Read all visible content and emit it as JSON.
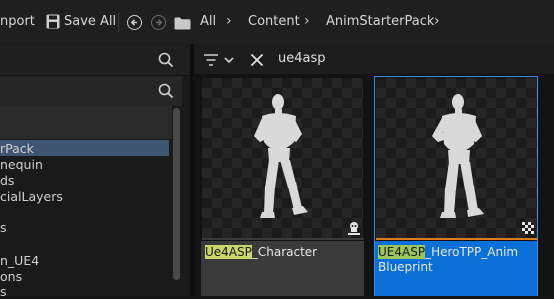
{
  "toolbar": {
    "import_label": "nport",
    "save_all_label": "Save All"
  },
  "breadcrumb": [
    "All",
    "Content",
    "AnimStarterPack"
  ],
  "search": {
    "query": "ue4asp"
  },
  "tree": {
    "items": [
      "rPack",
      "nequin",
      "ds",
      "cialLayers",
      "s",
      "n_UE4",
      "ons",
      "s"
    ],
    "selected_index": 0
  },
  "assets": [
    {
      "highlight": "Ue4ASP",
      "rest_line1": "_Character",
      "line2": "",
      "selected": false
    },
    {
      "highlight": "UE4ASP",
      "rest_line1": "_HeroTPP_Anim",
      "line2": "Blueprint",
      "selected": true
    }
  ],
  "colors": {
    "accent_blue": "#0a6fd6",
    "selection_border": "#3a8ee6",
    "highlight": "#c9d66a"
  }
}
